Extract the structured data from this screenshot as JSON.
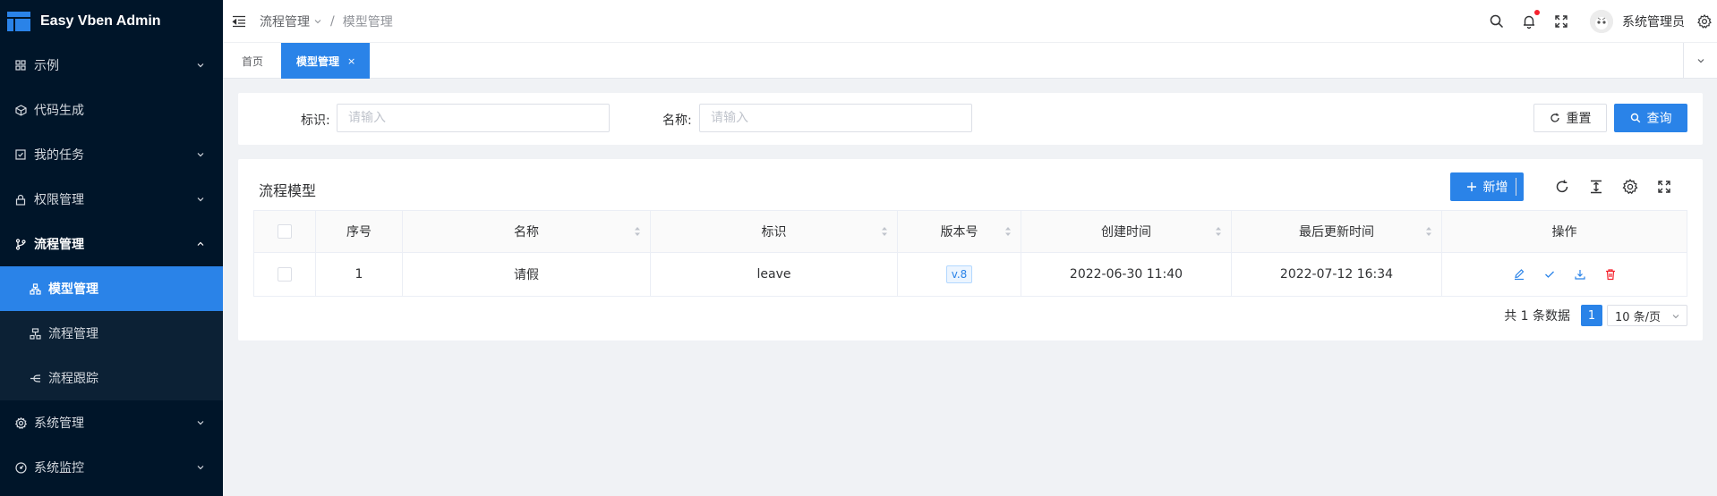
{
  "app": {
    "title": "Easy Vben Admin"
  },
  "sidebar": {
    "items": [
      {
        "label": "示例",
        "icon": "grid-icon"
      },
      {
        "label": "代码生成",
        "icon": "code-icon"
      },
      {
        "label": "我的任务",
        "icon": "check-square-icon"
      },
      {
        "label": "权限管理",
        "icon": "lock-icon"
      },
      {
        "label": "流程管理",
        "icon": "branch-icon"
      },
      {
        "label": "系统管理",
        "icon": "gear-icon"
      },
      {
        "label": "系统监控",
        "icon": "dashboard-icon"
      }
    ],
    "subitems": [
      {
        "label": "模型管理",
        "icon": "org-icon",
        "active": true
      },
      {
        "label": "流程管理",
        "icon": "tree-icon"
      },
      {
        "label": "流程跟踪",
        "icon": "track-icon"
      }
    ]
  },
  "header": {
    "breadcrumb": {
      "parent": "流程管理",
      "sep": "/",
      "current": "模型管理"
    },
    "user": "系统管理员"
  },
  "tabs": [
    {
      "label": "首页"
    },
    {
      "label": "模型管理",
      "close": "×",
      "active": true
    }
  ],
  "search": {
    "field1": {
      "label": "标识:",
      "placeholder": "请输入"
    },
    "field2": {
      "label": "名称:",
      "placeholder": "请输入"
    },
    "reset": "重置",
    "query": "查询"
  },
  "table": {
    "title": "流程模型",
    "add": "新增",
    "columns": [
      "序号",
      "名称",
      "标识",
      "版本号",
      "创建时间",
      "最后更新时间",
      "操作"
    ],
    "rows": [
      {
        "index": "1",
        "name": "请假",
        "key": "leave",
        "version": "v.8",
        "created": "2022-06-30 11:40",
        "updated": "2022-07-12 16:34"
      }
    ],
    "pagination": {
      "total": "共 1 条数据",
      "page": "1",
      "size": "10 条/页"
    }
  },
  "colors": {
    "primary": "#2a83e8",
    "sidebar": "#001529",
    "danger": "#f5222d"
  }
}
